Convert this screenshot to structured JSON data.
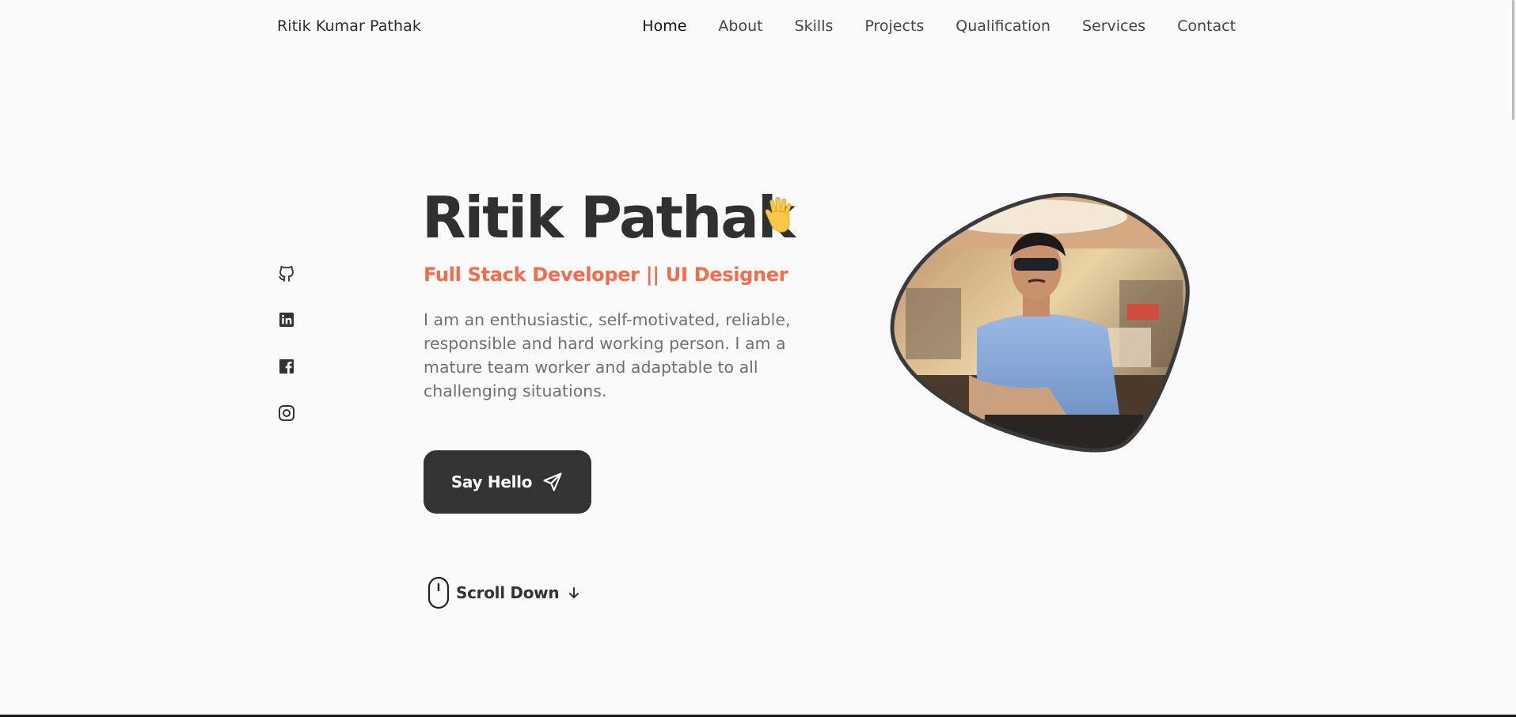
{
  "header": {
    "brand": "Ritik Kumar Pathak",
    "nav": [
      "Home",
      "About",
      "Skills",
      "Projects",
      "Qualification",
      "Services",
      "Contact"
    ],
    "active": "Home"
  },
  "social": [
    "github-icon",
    "linkedin-icon",
    "facebook-icon",
    "instagram-icon"
  ],
  "hero": {
    "name": "Ritik Pathak",
    "wave_icon": "waving-hand-icon",
    "role": "Full Stack Developer || UI Designer",
    "description": "I am an enthusiastic, self-motivated, reliable, responsible and hard working person. I am a mature team worker and adaptable to all challenging situations.",
    "cta_label": "Say Hello",
    "cta_icon": "send-icon",
    "scroll_label": "Scroll Down",
    "scroll_icon": "mouse-icon"
  },
  "colors": {
    "background": "#fafafa",
    "text": "#333333",
    "accent": "#f26b4d",
    "button": "#333333"
  }
}
